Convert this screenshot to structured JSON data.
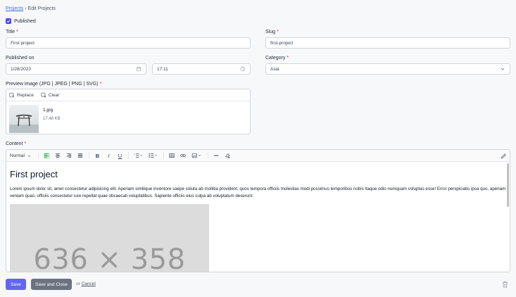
{
  "breadcrumb": {
    "parent": "Projects",
    "separator": "›",
    "current": "Edit Projects"
  },
  "published": {
    "label": "Published",
    "checked": true
  },
  "title": {
    "label": "Title",
    "value": "First project",
    "required": "*"
  },
  "slug": {
    "label": "Slug",
    "value": "first-project",
    "required": "*"
  },
  "published_on": {
    "label": "Published on",
    "date": "1/28/2023",
    "time": "17:11"
  },
  "category": {
    "label": "Category",
    "value": "Asia",
    "required": "*"
  },
  "preview_image": {
    "label": "Preview image (JPG | JPEG | PNG | SVG)",
    "required": "*",
    "replace_label": "Replace",
    "clear_label": "Clear",
    "file_name": "1.jpg",
    "file_size": "17.48 KB"
  },
  "content": {
    "label": "Content",
    "required": "*",
    "format": "Normal",
    "heading": "First project",
    "paragraph": "Lorem ipsum dolor sit, amet consectetur adipisicing elit. Aperiam similique inventore saepe soluta ab mollitia provident, quos tempora officiis molestias modi possimus temporibus nobis itaque odio numquam voluptas esse! Error perspiciatis ipsa quo, aperiam veniam quas, officiis consectetur iure repellat quae obcaecati voluptatibus. Sapiente officiis eius culpa ab voluptatum deserunt.",
    "placeholder_text": "636 × 358"
  },
  "footer": {
    "save_label": "Save",
    "save_close_label": "Save and Close",
    "or_text": "or",
    "cancel_label": "Cancel"
  },
  "colors": {
    "primary": "#6366f1",
    "secondary": "#6b7280",
    "required": "#dc2626",
    "link": "#3b6fd4"
  }
}
